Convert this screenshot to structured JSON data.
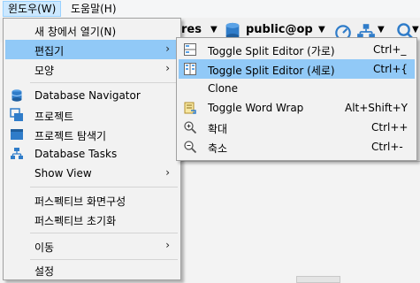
{
  "menubar": {
    "window_label": "윈도우(W)",
    "help_label": "도움말(H)"
  },
  "toolbar": {
    "res_text": "res",
    "db_text": "public@op"
  },
  "window_menu": {
    "items": [
      {
        "label": "새 창에서 열기(N)"
      },
      {
        "label": "편집기"
      },
      {
        "label": "모양"
      },
      {
        "label": "Database Navigator",
        "icon": "database-navigator-icon"
      },
      {
        "label": "프로젝트",
        "icon": "projects-icon"
      },
      {
        "label": "프로젝트 탐색기",
        "icon": "project-explorer-icon"
      },
      {
        "label": "Database Tasks",
        "icon": "database-tasks-icon"
      },
      {
        "label": "Show View"
      },
      {
        "label": "퍼스펙티브 화면구성"
      },
      {
        "label": "퍼스펙티브 초기화"
      },
      {
        "label": "이동"
      },
      {
        "label": "설정"
      }
    ]
  },
  "editor_submenu": {
    "items": [
      {
        "label": "Toggle Split Editor (가로)",
        "shortcut": "Ctrl+_",
        "icon": "split-horizontal-icon"
      },
      {
        "label": "Toggle Split Editor (세로)",
        "shortcut": "Ctrl+{",
        "icon": "split-vertical-icon"
      },
      {
        "label": "Clone",
        "shortcut": ""
      },
      {
        "label": "Toggle Word Wrap",
        "shortcut": "Alt+Shift+Y",
        "icon": "word-wrap-icon"
      },
      {
        "label": "확대",
        "shortcut": "Ctrl++",
        "icon": "zoom-in-icon"
      },
      {
        "label": "축소",
        "shortcut": "Ctrl+-",
        "icon": "zoom-out-icon"
      }
    ]
  },
  "colors": {
    "highlight": "#91c9f7",
    "menubar_active": "#cce8ff",
    "db_icon": "#2f7cc9"
  }
}
